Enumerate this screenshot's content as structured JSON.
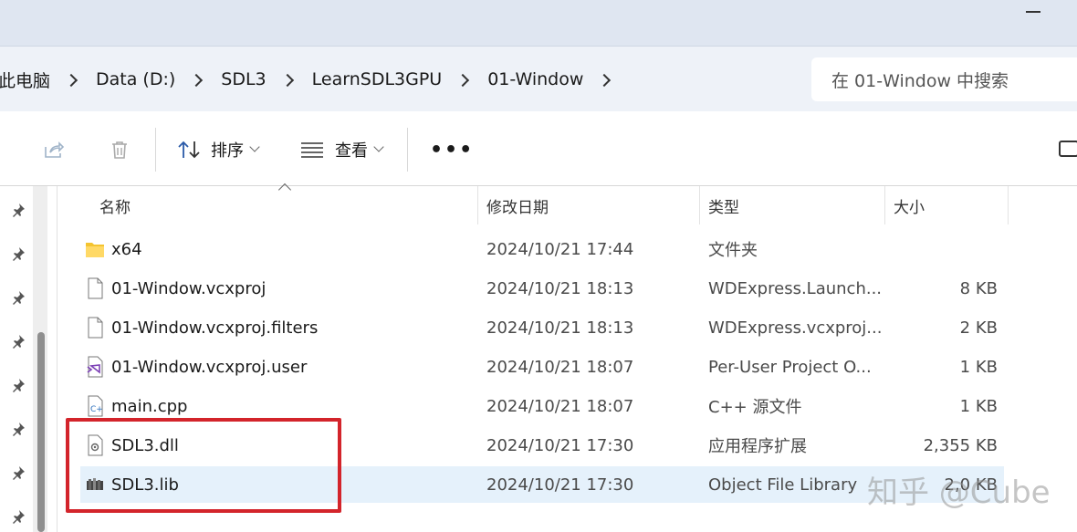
{
  "breadcrumb": [
    "此电脑",
    "Data (D:)",
    "SDL3",
    "LearnSDL3GPU",
    "01-Window"
  ],
  "search": {
    "placeholder": "在 01-Window 中搜索"
  },
  "toolbar": {
    "sort_label": "排序",
    "view_label": "查看",
    "more_label": "•••"
  },
  "columns": {
    "name": "名称",
    "date": "修改日期",
    "type": "类型",
    "size": "大小"
  },
  "files": [
    {
      "name": "x64",
      "date": "2024/10/21 17:44",
      "type": "文件夹",
      "size": "",
      "icon": "folder-icon"
    },
    {
      "name": "01-Window.vcxproj",
      "date": "2024/10/21 18:13",
      "type": "WDExpress.Launch...",
      "size": "8 KB",
      "icon": "file-icon"
    },
    {
      "name": "01-Window.vcxproj.filters",
      "date": "2024/10/21 18:13",
      "type": "WDExpress.vcxproj....",
      "size": "2 KB",
      "icon": "file-icon"
    },
    {
      "name": "01-Window.vcxproj.user",
      "date": "2024/10/21 18:07",
      "type": "Per-User Project O...",
      "size": "1 KB",
      "icon": "visual-studio-file-icon"
    },
    {
      "name": "main.cpp",
      "date": "2024/10/21 18:07",
      "type": "C++ 源文件",
      "size": "1 KB",
      "icon": "cpp-file-icon"
    },
    {
      "name": "SDL3.dll",
      "date": "2024/10/21 17:30",
      "type": "应用程序扩展",
      "size": "2,355 KB",
      "icon": "dll-file-icon"
    },
    {
      "name": "SDL3.lib",
      "date": "2024/10/21 17:30",
      "type": "Object File Library",
      "size": "2,0 KB",
      "icon": "lib-file-icon"
    }
  ],
  "watermark": "知乎 @Cube",
  "colors": {
    "selection": "#e5f1fb",
    "highlight_box": "#d3242b",
    "address_bg": "#eef2f8"
  }
}
